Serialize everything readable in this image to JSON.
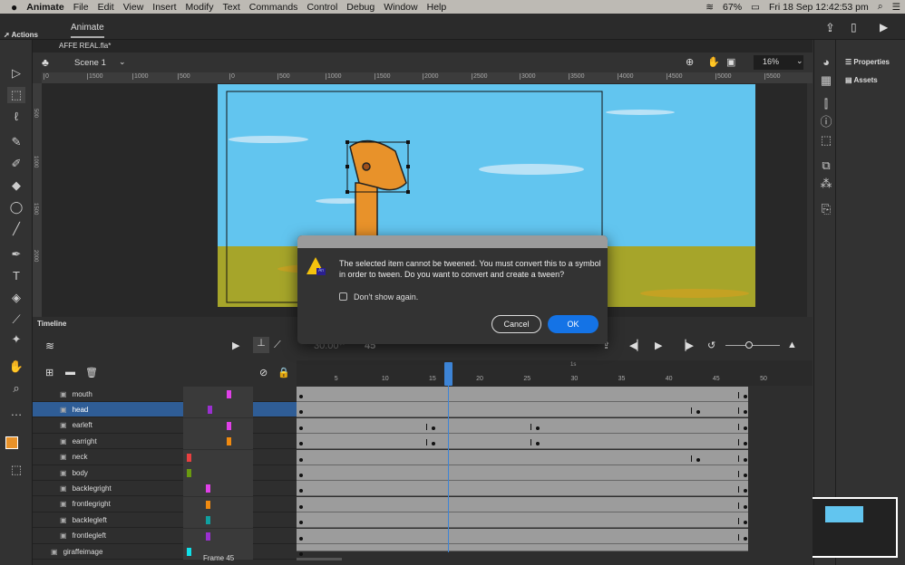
{
  "menubar": {
    "app": "Animate",
    "items": [
      "File",
      "Edit",
      "View",
      "Insert",
      "Modify",
      "Text",
      "Commands",
      "Control",
      "Debug",
      "Window",
      "Help"
    ],
    "battery": "67%",
    "clock": "Fri 18 Sep  12:42:53 pm"
  },
  "workspace": {
    "tab": "Animate",
    "actions_label": "Actions"
  },
  "document": {
    "tab": "AFFE REAL.fla*"
  },
  "scene": {
    "name": "Scene 1",
    "zoom": "16%"
  },
  "ruler": {
    "ticks": [
      "0",
      "1500",
      "1000",
      "500",
      "0",
      "500",
      "1000",
      "1500",
      "2000",
      "2500",
      "3000",
      "3500",
      "4000",
      "4500",
      "5000",
      "5500"
    ]
  },
  "vruler": {
    "ticks": [
      "500",
      "1000",
      "1500",
      "2000"
    ]
  },
  "right_panel": {
    "properties": "Properties",
    "assets": "Assets"
  },
  "dialog": {
    "message": "The selected item cannot be tweened. You must convert this to a symbol in order to tween. Do you want to convert and create a tween?",
    "checkbox_label": "Don't show again.",
    "checkbox_checked": false,
    "cancel": "Cancel",
    "ok": "OK",
    "icon_badge": "An"
  },
  "timeline": {
    "title": "Timeline",
    "fps": "30.00",
    "fps_unit": "fps",
    "current_frame": "45",
    "status": "Frame 45",
    "seconds_marker": "1s",
    "frame_labels": [
      "5",
      "10",
      "15",
      "20",
      "25",
      "30",
      "35",
      "40",
      "45",
      "50"
    ],
    "layers": [
      {
        "name": "mouth",
        "keyframes": [
          1,
          48
        ],
        "color": "#e040e8"
      },
      {
        "name": "head",
        "keyframes": [
          1,
          43,
          48
        ],
        "color": "#9a30d0",
        "selected": true
      },
      {
        "name": "earleft",
        "keyframes": [
          1,
          15,
          26,
          48
        ],
        "color": "#e040e8"
      },
      {
        "name": "earright",
        "keyframes": [
          1,
          15,
          26,
          48
        ],
        "color": "#f08a10"
      },
      {
        "name": "neck",
        "keyframes": [
          1,
          43,
          48
        ],
        "color": "#e84040"
      },
      {
        "name": "body",
        "keyframes": [
          1,
          48
        ],
        "color": "#6a9a10"
      },
      {
        "name": "backlegright",
        "keyframes": [
          1,
          48
        ],
        "color": "#e040e8"
      },
      {
        "name": "frontlegright",
        "keyframes": [
          1,
          48
        ],
        "color": "#f08a10"
      },
      {
        "name": "backlegleft",
        "keyframes": [
          1,
          48
        ],
        "color": "#10a0a0"
      },
      {
        "name": "frontlegleft",
        "keyframes": [
          1,
          48
        ],
        "color": "#9a30d0"
      },
      {
        "name": "giraffeimage",
        "keyframes": [
          1
        ],
        "color": "#10e0e8"
      }
    ]
  },
  "colors": {
    "accent": "#1473e6",
    "sky": "#62c5ef",
    "grass": "#a6a52a",
    "stroke_fill": "#e8922a",
    "selection": "#2f5d96"
  }
}
